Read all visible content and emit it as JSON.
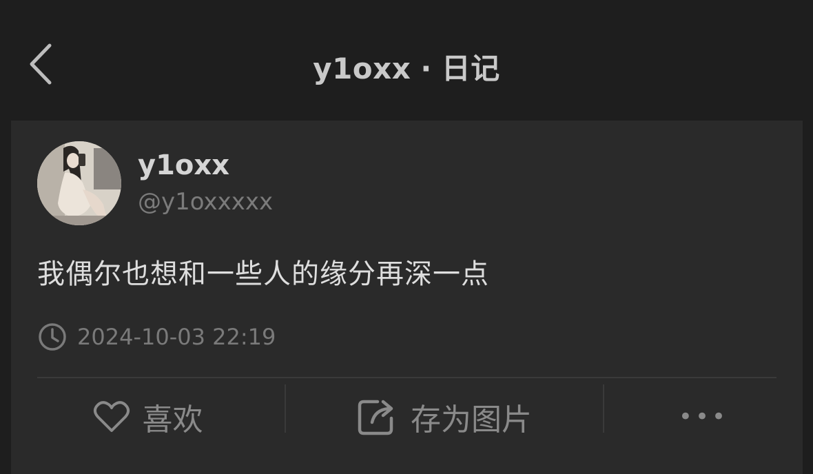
{
  "header": {
    "username": "y1oxx",
    "separator": "·",
    "section": "日记"
  },
  "post": {
    "display_name": "y1oxx",
    "handle": "@y1oxxxxx",
    "text": "我偶尔也想和一些人的缘分再深一点",
    "timestamp": "2024-10-03 22:19"
  },
  "actions": {
    "like_label": "喜欢",
    "save_label": "存为图片",
    "more_label": "•••"
  },
  "icons": {
    "back": "chevron-left-icon",
    "clock": "clock-icon",
    "like": "heart-icon",
    "save": "share-image-icon",
    "more": "more-dots-icon"
  },
  "colors": {
    "background": "#1e1e1e",
    "card": "#2a2a2a",
    "primary_text": "#dedede",
    "secondary_text": "#7a7a7a"
  }
}
